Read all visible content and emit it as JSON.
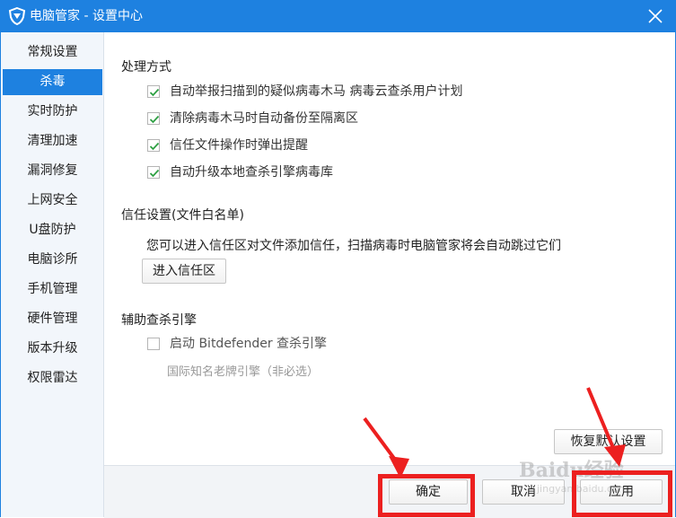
{
  "window": {
    "title": "电脑管家 - 设置中心",
    "logo_icon": "shield-icon",
    "close_icon": "close-icon",
    "accent": "#1e81e0"
  },
  "sidebar": {
    "items": [
      {
        "label": "常规设置",
        "active": false
      },
      {
        "label": "杀毒",
        "active": true
      },
      {
        "label": "实时防护",
        "active": false
      },
      {
        "label": "清理加速",
        "active": false
      },
      {
        "label": "漏洞修复",
        "active": false
      },
      {
        "label": "上网安全",
        "active": false
      },
      {
        "label": "U盘防护",
        "active": false
      },
      {
        "label": "电脑诊所",
        "active": false
      },
      {
        "label": "手机管理",
        "active": false
      },
      {
        "label": "硬件管理",
        "active": false
      },
      {
        "label": "版本升级",
        "active": false
      },
      {
        "label": "权限雷达",
        "active": false
      }
    ]
  },
  "handling": {
    "title": "处理方式",
    "options": [
      {
        "label": "自动举报扫描到的疑似病毒木马  病毒云查杀用户计划",
        "checked": true
      },
      {
        "label": "清除病毒木马时自动备份至隔离区",
        "checked": true
      },
      {
        "label": "信任文件操作时弹出提醒",
        "checked": true
      },
      {
        "label": "自动升级本地查杀引擎病毒库",
        "checked": true
      }
    ]
  },
  "trust": {
    "title": "信任设置(文件白名单)",
    "description": "您可以进入信任区对文件添加信任，扫描病毒时电脑管家将会自动跳过它们",
    "button_label": "进入信任区"
  },
  "engine": {
    "title": "辅助查杀引擎",
    "option_label": "启动 Bitdefender 查杀引擎",
    "option_checked": false,
    "hint": "国际知名老牌引擎（非必选）"
  },
  "footer": {
    "restore_label": "恢复默认设置",
    "ok_label": "确定",
    "cancel_label": "取消",
    "apply_label": "应用"
  },
  "annotation": {
    "color": "#ec2020"
  },
  "watermark": {
    "text": "Baidu经验",
    "sub": "jingyan.baidu.com"
  }
}
